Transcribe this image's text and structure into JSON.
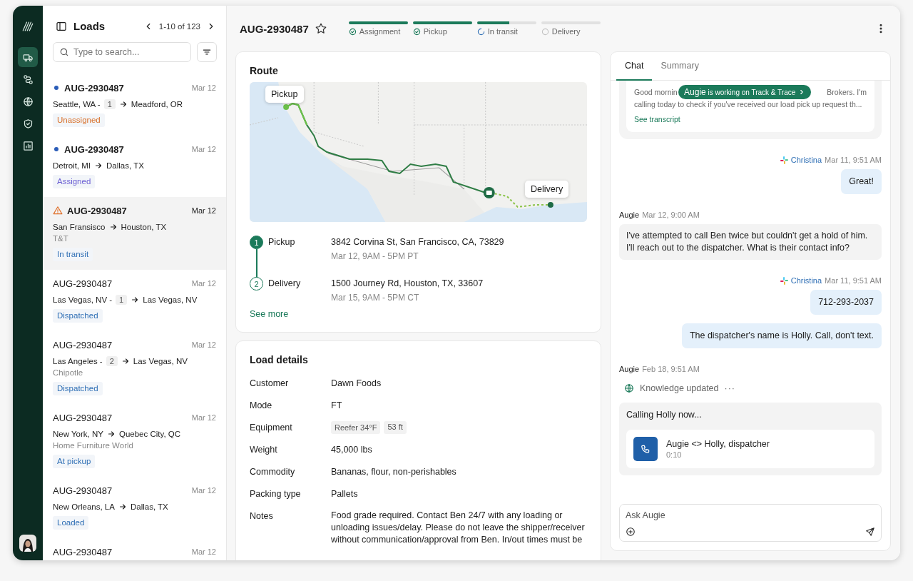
{
  "sidebar": {
    "nav": [
      {
        "selected": true
      },
      {
        "selected": false
      },
      {
        "selected": false
      },
      {
        "selected": false
      },
      {
        "selected": false
      }
    ]
  },
  "loads": {
    "title": "Loads",
    "pagination": "1-10 of 123",
    "search": {
      "placeholder": "Type to search..."
    },
    "items": [
      {
        "id": "AUG-2930487",
        "date": "Mar 12",
        "unread": true,
        "flagged": false,
        "origin": "Seattle, WA -",
        "stops": "1",
        "destination": "Meadford, OR",
        "status": "Unassigned",
        "color": "#d9702a",
        "selected": false
      },
      {
        "id": "AUG-2930487",
        "date": "Mar 12",
        "unread": true,
        "flagged": false,
        "origin": "Detroit, MI",
        "destination": "Dallas, TX",
        "status": "Assigned",
        "color": "#6b5fd3",
        "selected": false
      },
      {
        "id": "AUG-2930487",
        "date": "Mar 12",
        "unread": true,
        "flagged": true,
        "origin": "San Fransisco",
        "destination": "Houston, TX",
        "customer": "T&T",
        "status": "In transit",
        "color": "#2f6fb5",
        "selected": true
      },
      {
        "id": "AUG-2930487",
        "date": "Mar 12",
        "unread": false,
        "flagged": false,
        "origin": "Las Vegas, NV -",
        "stops": "1",
        "destination": "Las Vegas, NV",
        "status": "Dispatched",
        "color": "#2f6fb5",
        "selected": false
      },
      {
        "id": "AUG-2930487",
        "date": "Mar 12",
        "unread": false,
        "flagged": false,
        "origin": "Las Angeles -",
        "stops": "2",
        "destination": "Las Vegas, NV",
        "customer": "Chipotle",
        "status": "Dispatched",
        "color": "#2f6fb5",
        "selected": false
      },
      {
        "id": "AUG-2930487",
        "date": "Mar 12",
        "unread": false,
        "flagged": false,
        "origin": "New York, NY",
        "destination": "Quebec City, QC",
        "customer": "Home Furniture World",
        "status": "At pickup",
        "color": "#2f6fb5",
        "selected": false
      },
      {
        "id": "AUG-2930487",
        "date": "Mar 12",
        "unread": false,
        "flagged": false,
        "origin": "New Orleans, LA",
        "destination": "Dallas, TX",
        "status": "Loaded",
        "color": "#2f6fb5",
        "selected": false
      },
      {
        "id": "AUG-2930487",
        "date": "Mar 12",
        "unread": false,
        "flagged": false,
        "selected": false
      }
    ]
  },
  "header": {
    "title": "AUG-2930487",
    "starred": false,
    "steps": [
      {
        "label": "Assignment",
        "kind": "done",
        "level": 1
      },
      {
        "label": "Pickup",
        "kind": "done",
        "level": 1
      },
      {
        "label": "In transit",
        "kind": "active",
        "level": 0.55
      },
      {
        "label": "Delivery",
        "kind": "pending"
      }
    ]
  },
  "route": {
    "title": "Route",
    "map": {
      "pickup_label": "Pickup",
      "delivery_label": "Delivery"
    },
    "stops": [
      {
        "number": "1",
        "label": "Pickup",
        "address": "3842 Corvina St, San Francisco, CA, 73829",
        "window": "Mar 12, 9AM - 5PM PT",
        "completed": true
      },
      {
        "number": "2",
        "label": "Delivery",
        "address": "1500 Journey Rd, Houston, TX, 33607",
        "window": "Mar 15, 9AM - 5PM CT",
        "completed": false
      }
    ],
    "see_more": "See more"
  },
  "details": {
    "title": "Load details",
    "rows": [
      {
        "label": "Customer",
        "value": "Dawn Foods"
      },
      {
        "label": "Mode",
        "value": "FT"
      },
      {
        "label": "Equipment",
        "tags": [
          "Reefer 34°F",
          "53 ft"
        ]
      },
      {
        "label": "Weight",
        "value": "45,000 lbs"
      },
      {
        "label": "Commodity",
        "value": "Bananas, flour, non-perishables"
      },
      {
        "label": "Packing type",
        "value": "Pallets"
      },
      {
        "label": "Notes",
        "value": "Food grade required. Contact Ben 24/7 with any loading or unloading issues/delay. Please do not leave the shipper/receiver without communication/approval from Ben. In/out times must be"
      }
    ]
  },
  "chat": {
    "tabs": [
      {
        "label": "Chat",
        "selected": true
      },
      {
        "label": "Summary",
        "selected": false
      }
    ],
    "banner": "**Augie** is working on Track & Trace",
    "transcript": {
      "line_start": "Good mornin",
      "line_end": "Brokers. I'm",
      "line_2": "calling today to check if you've received our load pick up request th...",
      "link": "See transcript"
    },
    "entries": [
      {
        "kind": "meta",
        "outgoing": true,
        "sender": "Christina",
        "time": "Mar 11, 9:51 AM"
      },
      {
        "kind": "bubble",
        "outgoing": true,
        "text": "Great!"
      },
      {
        "kind": "meta",
        "outgoing": false,
        "sender": "Augie",
        "time": "Mar 12, 9:00 AM"
      },
      {
        "kind": "bubble",
        "outgoing": false,
        "text": "I've attempted to call Ben twice but couldn't get a hold of him. I'll reach out to the dispatcher. What is their contact info?"
      },
      {
        "kind": "meta",
        "outgoing": true,
        "sender": "Christina",
        "time": "Mar 11, 9:51 AM"
      },
      {
        "kind": "bubble",
        "outgoing": true,
        "text": "712-293-2037"
      },
      {
        "kind": "bubble",
        "outgoing": true,
        "text": "The dispatcher's name is Holly. Call, don't text."
      },
      {
        "kind": "meta",
        "outgoing": false,
        "sender": "Augie",
        "time": "Feb 18, 9:51 AM"
      },
      {
        "kind": "event",
        "text": "Knowledge updated",
        "more": "···"
      },
      {
        "kind": "call",
        "text": "Calling Holly now...",
        "title": "Augie <> Holly, dispatcher",
        "duration": "0:10"
      }
    ],
    "composer": {
      "placeholder": "Ask Augie"
    }
  }
}
